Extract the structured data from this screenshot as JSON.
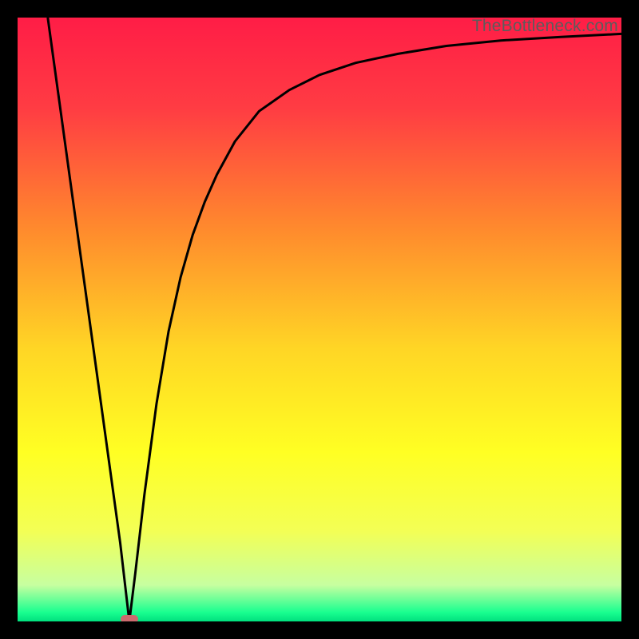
{
  "watermark": "TheBottleneck.com",
  "colors": {
    "frame": "#000000",
    "gradient_stops": [
      {
        "offset": 0.0,
        "color": "#ff1d46"
      },
      {
        "offset": 0.15,
        "color": "#ff3c43"
      },
      {
        "offset": 0.35,
        "color": "#ff8a2d"
      },
      {
        "offset": 0.55,
        "color": "#ffd625"
      },
      {
        "offset": 0.72,
        "color": "#ffff23"
      },
      {
        "offset": 0.85,
        "color": "#f3ff55"
      },
      {
        "offset": 0.94,
        "color": "#c7ffa0"
      },
      {
        "offset": 0.985,
        "color": "#19ff90"
      },
      {
        "offset": 1.0,
        "color": "#00e07e"
      }
    ],
    "curve": "#000000",
    "bump": "#cc6a6e"
  },
  "chart_data": {
    "type": "line",
    "title": "",
    "xlabel": "",
    "ylabel": "",
    "xlim": [
      0,
      1000
    ],
    "ylim": [
      0,
      1000
    ],
    "series": [
      {
        "name": "bottleneck-curve",
        "description": "V-shaped bottleneck curve; y is mismatch magnitude (0 = bottom/green/optimal, 1000 = top/red/severe). Minimum at x≈185.",
        "x": [
          50,
          70,
          90,
          110,
          130,
          150,
          170,
          185,
          195,
          210,
          230,
          250,
          270,
          290,
          310,
          330,
          360,
          400,
          450,
          500,
          560,
          630,
          710,
          800,
          900,
          1000
        ],
        "y": [
          1000,
          855,
          710,
          565,
          420,
          275,
          130,
          0,
          80,
          210,
          360,
          480,
          570,
          640,
          695,
          740,
          795,
          845,
          880,
          905,
          925,
          940,
          953,
          962,
          968,
          973
        ]
      }
    ],
    "annotations": [
      {
        "name": "optimal-bump",
        "x": 185,
        "y": 0,
        "shape": "pill",
        "color": "#cc6a6e"
      }
    ]
  }
}
